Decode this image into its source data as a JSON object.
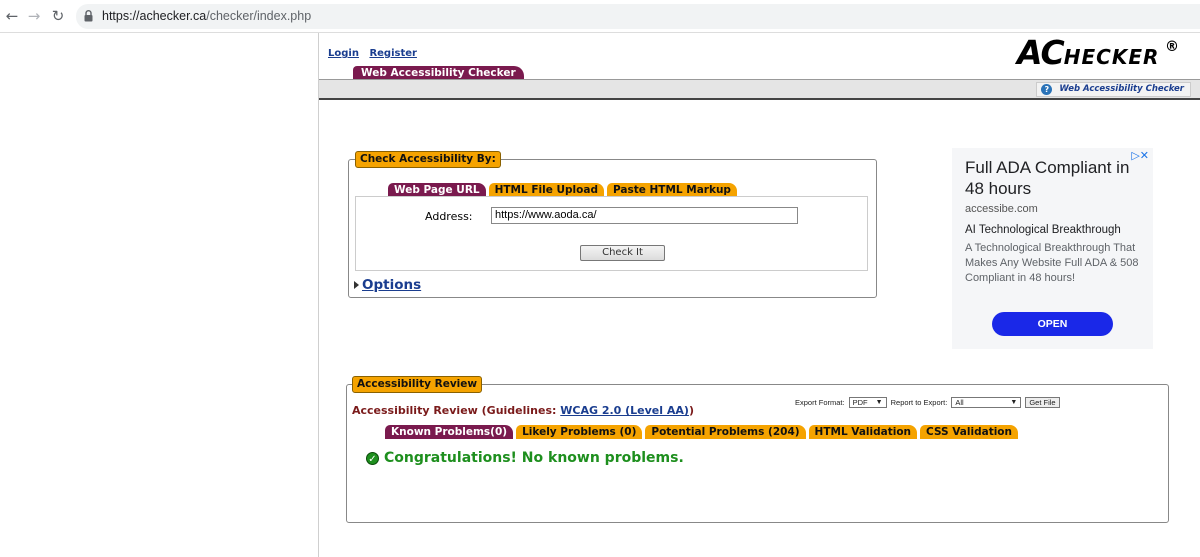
{
  "browser": {
    "url_host": "https://achecker.ca",
    "url_path": "/checker/index.php"
  },
  "header": {
    "login": "Login",
    "register": "Register",
    "logo_big": "AC",
    "logo_small": "HECKER",
    "logo_reg": "®",
    "main_tab": "Web Accessibility Checker",
    "help_link": "Web Accessibility Checker"
  },
  "check": {
    "legend": "Check Accessibility By:",
    "tabs": [
      "Web Page URL",
      "HTML File Upload",
      "Paste HTML Markup"
    ],
    "address_label": "Address:",
    "address_value": "https://www.aoda.ca/",
    "check_button": "Check It",
    "options_label": "Options"
  },
  "ad": {
    "close": "▷✕",
    "title": "Full ADA Compliant in 48 hours",
    "domain": "accessibe.com",
    "headline": "AI Technological Breakthrough",
    "body": "A Technological Breakthrough That Makes Any Website Full ADA & 508 Compliant in 48 hours!",
    "button": "OPEN"
  },
  "review": {
    "legend": "Accessibility Review",
    "title_prefix": "Accessibility Review (Guidelines: ",
    "guideline_link": "WCAG 2.0 (Level AA)",
    "title_suffix": ")",
    "export_format_label": "Export Format:",
    "export_format_value": "PDF",
    "report_label": "Report to Export:",
    "report_value": "All",
    "get_file": "Get File",
    "tabs": [
      "Known Problems(0)",
      "Likely Problems (0)",
      "Potential Problems (204)",
      "HTML Validation",
      "CSS Validation"
    ],
    "message": "Congratulations! No known problems."
  }
}
